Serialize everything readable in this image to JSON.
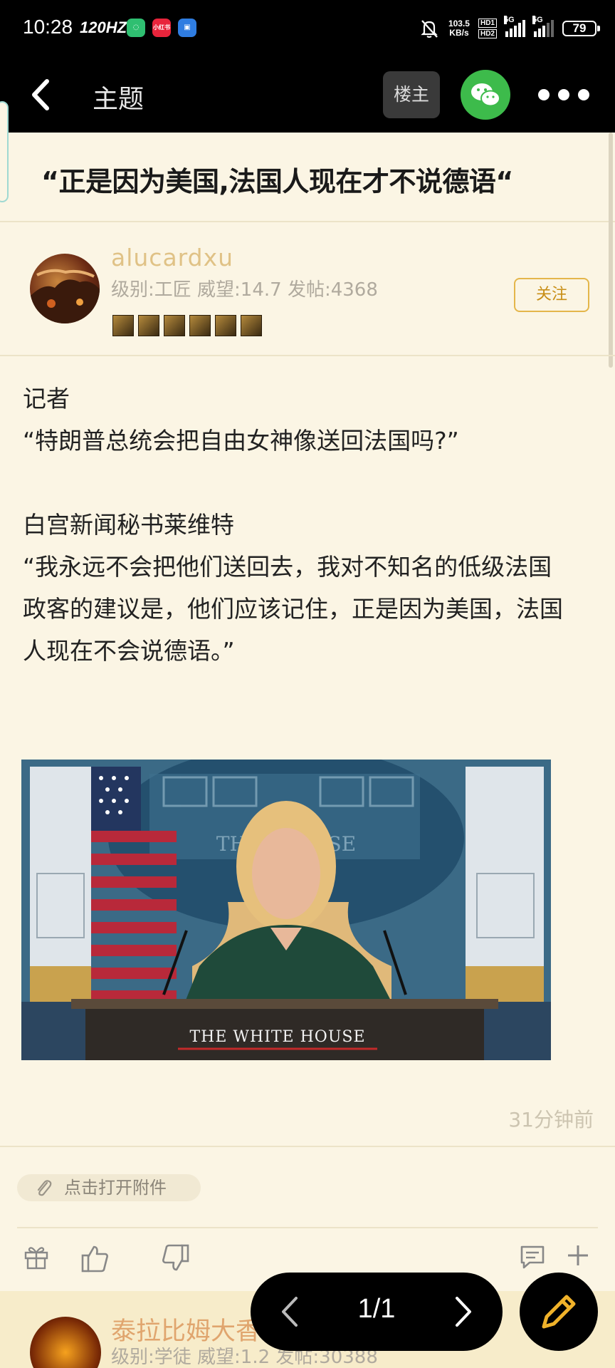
{
  "status_bar": {
    "time": "10:28",
    "refresh_rate": "120HZ",
    "app_icon_2": "小红书",
    "net_speed_value": "103.5",
    "net_speed_unit": "KB/s",
    "hd1": "HD1",
    "hd2": "HD2",
    "sig1": "5G",
    "sig2": "5G",
    "battery": "79"
  },
  "header": {
    "title": "主题",
    "owner_button": "楼主",
    "icons": [
      "back-arrow-icon",
      "wechat-icon",
      "more-icon"
    ]
  },
  "thread": {
    "title": "“正是因为美国,法国人现在才不说德语“"
  },
  "author": {
    "username": "alucardxu",
    "info": "级别:工匠 威望:14.7 发帖:4368",
    "follow_label": "关注",
    "badge_count": 6
  },
  "post": {
    "lines": [
      "记者",
      "“特朗普总统会把自由女神像送回法国吗?”",
      "",
      "白宫新闻秘书莱维特",
      "“我永远不会把他们送回去，我对不知名的低级法国",
      "政客的建议是，他们应该记住，正是因为美国，法国",
      "人现在不会说德语。”"
    ],
    "image_caption": "THE WHITE HOUSE",
    "image_backdrop_text": "THE W    OUSE",
    "time": "31分钟前",
    "attachment_label": "点击打开附件"
  },
  "actions": {
    "icons": [
      "gift-icon",
      "thumbs-up-icon",
      "thumbs-down-icon",
      "comment-icon",
      "plus-icon"
    ]
  },
  "next_reply": {
    "username": "泰拉比姆大香",
    "info": "级别:学徒 威望:1.2 发帖:30388"
  },
  "pager": {
    "text": "1/1"
  },
  "colors": {
    "background": "#fbf5e4",
    "accent": "#e4b64a",
    "username": "#e0c286",
    "wechat": "#3dbb4b"
  }
}
